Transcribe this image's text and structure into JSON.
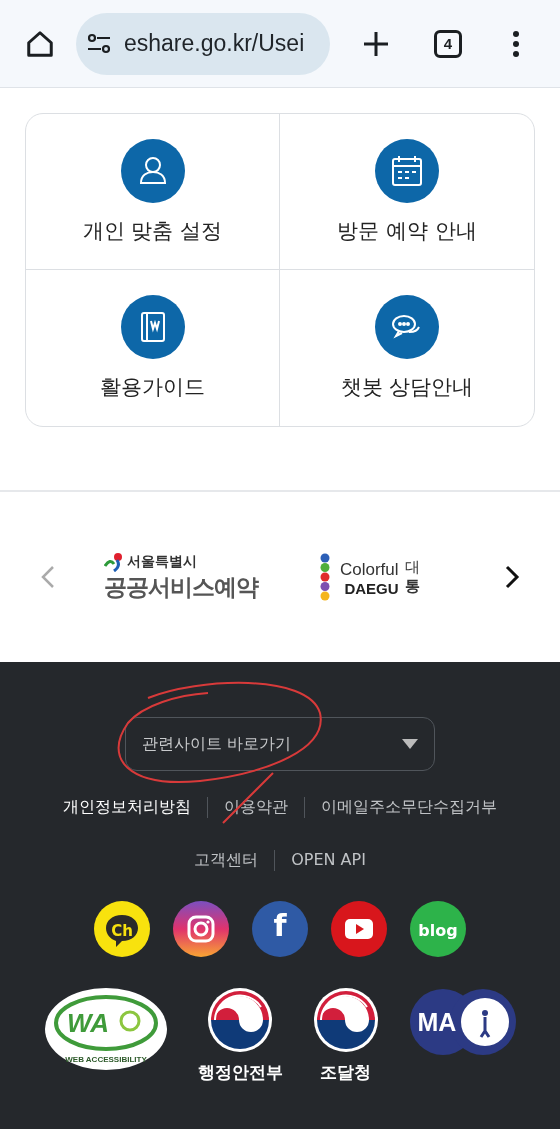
{
  "browser": {
    "url": "eshare.go.kr/Usei",
    "tab_count": "4"
  },
  "menu": [
    {
      "label": "개인 맞춤 설정",
      "kind": "person"
    },
    {
      "label": "방문 예약 안내",
      "kind": "calendar"
    },
    {
      "label": "활용가이드",
      "kind": "book"
    },
    {
      "label": "챗봇 상담안내",
      "kind": "chat"
    }
  ],
  "partners": [
    {
      "kind": "seoul",
      "top": "서울특별시",
      "bottom": "공공서비스예약"
    },
    {
      "kind": "daegu",
      "top": "Colorful",
      "bottom": "DAEGU",
      "side_top": "대",
      "side_bottom": "통"
    }
  ],
  "footer": {
    "select": {
      "placeholder": "관련사이트 바로가기"
    },
    "links": [
      {
        "label": "개인정보처리방침",
        "emphasis": true
      },
      {
        "label": "이용약관",
        "emphasis": false
      },
      {
        "label": "이메일주소무단수집거부",
        "emphasis": false
      },
      {
        "label": "고객센터",
        "emphasis": false
      },
      {
        "label": "OPEN API",
        "emphasis": false
      }
    ],
    "social": [
      {
        "kind": "kakao",
        "text": "Ch"
      },
      {
        "kind": "instagram"
      },
      {
        "kind": "facebook",
        "text": "f"
      },
      {
        "kind": "youtube"
      },
      {
        "kind": "blog",
        "text": "blog"
      }
    ],
    "marks": [
      {
        "kind": "wa",
        "text": "WA",
        "caption": "WEB ACCESSIBILITY"
      },
      {
        "kind": "gov",
        "label": "행정안전부"
      },
      {
        "kind": "gov",
        "label": "조달청"
      },
      {
        "kind": "ma",
        "text": "MA"
      }
    ]
  }
}
